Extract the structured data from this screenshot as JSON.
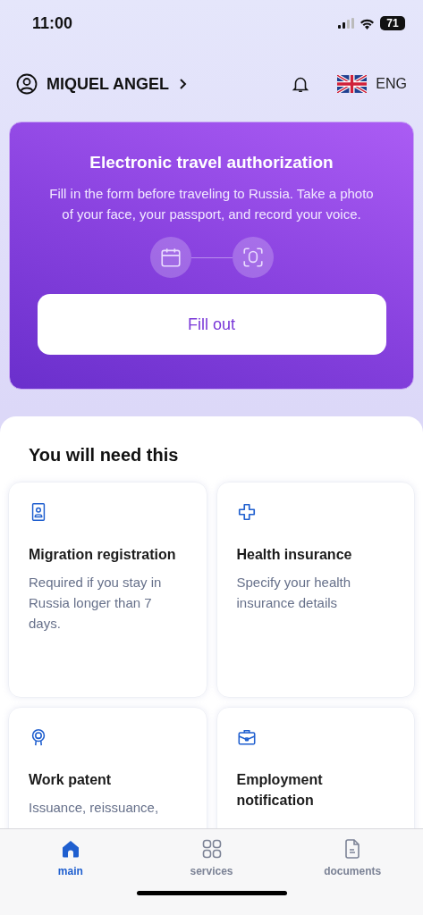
{
  "status_bar": {
    "time": "11:00",
    "battery": "71"
  },
  "header": {
    "user_name": "MIQUEL ANGEL",
    "language": "ENG"
  },
  "promo": {
    "title": "Electronic travel authorization",
    "text": "Fill in the form before traveling to Russia. Take a photo of your face, your passport, and record your voice.",
    "button": "Fill out"
  },
  "section": {
    "title": "You will need this",
    "cards": [
      {
        "kind": "registration",
        "title": "Migration registration",
        "text": "Required if you stay in Russia longer than 7 days."
      },
      {
        "kind": "insurance",
        "title": "Health insurance",
        "text": "Specify your health insurance details"
      },
      {
        "kind": "patent",
        "title": "Work patent",
        "text": "Issuance, reissuance,"
      },
      {
        "kind": "employment",
        "title": "Employment notification"
      }
    ]
  },
  "tab_bar": [
    {
      "kind": "home",
      "label": "main",
      "selected": true
    },
    {
      "kind": "grid",
      "label": "services",
      "selected": false
    },
    {
      "kind": "document",
      "label": "documents",
      "selected": false
    }
  ]
}
